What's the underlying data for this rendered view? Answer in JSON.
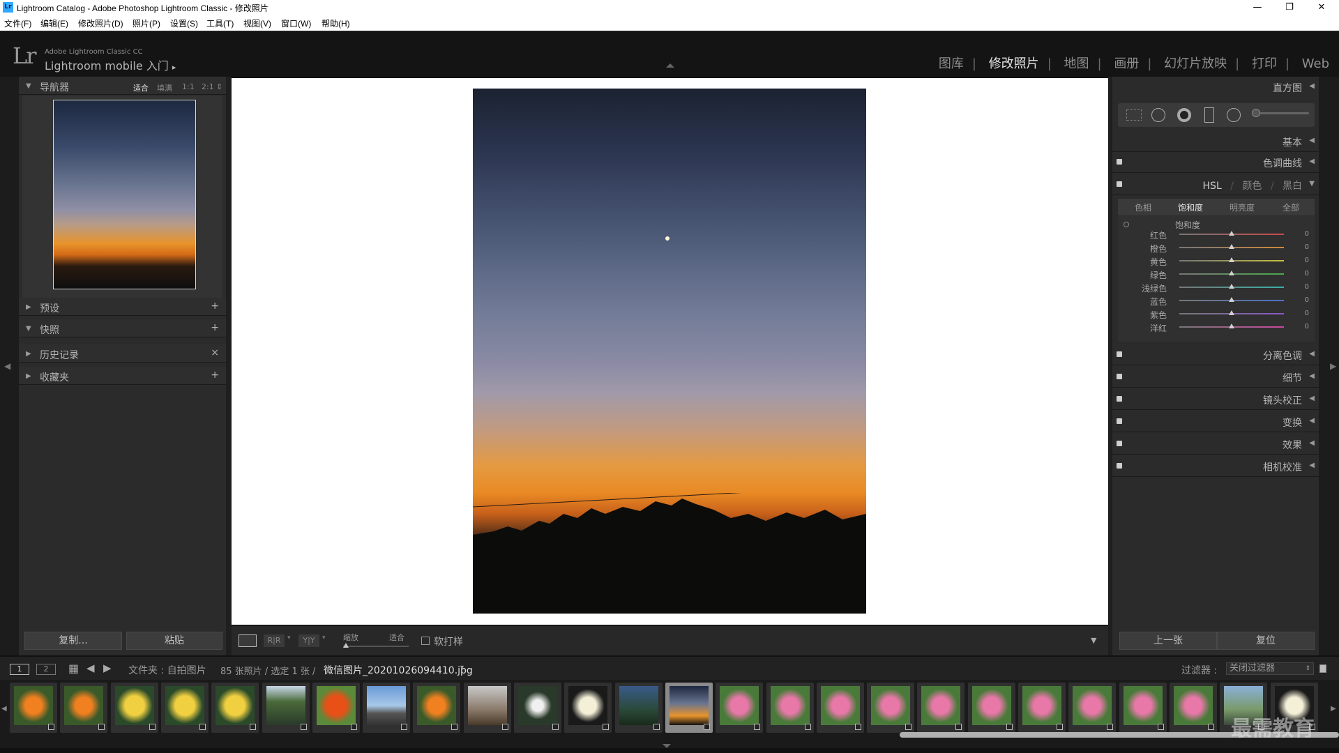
{
  "window": {
    "title": "Lightroom Catalog - Adobe Photoshop Lightroom Classic - 修改照片",
    "app_icon": "Lr",
    "controls": [
      "minimize-icon",
      "restore-icon",
      "close-icon"
    ]
  },
  "menu": [
    "文件(F)",
    "编辑(E)",
    "修改照片(D)",
    "照片(P)",
    "设置(S)",
    "工具(T)",
    "视图(V)",
    "窗口(W)",
    "帮助(H)"
  ],
  "identity": {
    "logo": "Lr",
    "product": "Adobe Lightroom Classic CC",
    "plate": "Lightroom mobile 入门",
    "arrow": "▸"
  },
  "modules": {
    "items": [
      "图库",
      "修改照片",
      "地图",
      "画册",
      "幻灯片放映",
      "打印",
      "Web"
    ],
    "active": "修改照片"
  },
  "left_panel": {
    "navigator": {
      "title": "导航器",
      "options": [
        "适合",
        "填满",
        "1:1",
        "2:1"
      ],
      "active_option": "适合"
    },
    "sections": [
      {
        "label": "预设",
        "action": "+",
        "expanded": false
      },
      {
        "label": "快照",
        "action": "+",
        "expanded": true
      },
      {
        "label": "历史记录",
        "action": "×",
        "expanded": false
      },
      {
        "label": "收藏夹",
        "action": "+",
        "expanded": false
      }
    ],
    "buttons": {
      "copy": "复制...",
      "paste": "粘贴"
    }
  },
  "right_panel": {
    "histogram": "直方图",
    "basic": "基本",
    "tone_curve": "色调曲线",
    "hsl_header": {
      "hsl": "HSL",
      "color": "颜色",
      "bw": "黑白",
      "sep": "/"
    },
    "hsl_tabs": [
      "色相",
      "饱和度",
      "明亮度",
      "全部"
    ],
    "hsl_active_tab": "饱和度",
    "group_label": "饱和度",
    "sliders": [
      {
        "name": "红色",
        "value": "0",
        "color": "#c84a4a"
      },
      {
        "name": "橙色",
        "value": "0",
        "color": "#d08a3a"
      },
      {
        "name": "黄色",
        "value": "0",
        "color": "#c8c040"
      },
      {
        "name": "绿色",
        "value": "0",
        "color": "#4aa84a"
      },
      {
        "name": "浅绿色",
        "value": "0",
        "color": "#3ab0a8"
      },
      {
        "name": "蓝色",
        "value": "0",
        "color": "#4a70c8"
      },
      {
        "name": "紫色",
        "value": "0",
        "color": "#8a5ac8"
      },
      {
        "name": "洋红",
        "value": "0",
        "color": "#c84aa0"
      }
    ],
    "panels": [
      "分离色调",
      "细节",
      "镜头校正",
      "变换",
      "效果",
      "相机校准"
    ],
    "buttons": {
      "prev": "上一张",
      "reset": "复位"
    }
  },
  "toolbar": {
    "zoom_label": "缩放",
    "fit_label": "适合",
    "soft_proof": "软打样"
  },
  "filmbar": {
    "page1": "1",
    "page2": "2",
    "folder_prefix": "文件夹 : 自拍图片",
    "count": "85 张照片 / 选定 1 张 /",
    "filename": "微信图片_20201026094410.jpg",
    "filter_label": "过滤器 :",
    "filter_value": "关闭过滤器"
  },
  "filmstrip": {
    "selected_index": 13,
    "thumbs": [
      "orange-flower",
      "orange-flower",
      "yellow-flower",
      "yellow-flower",
      "yellow-flower",
      "tree",
      "orange-lily",
      "building-sky",
      "orange-flower",
      "dry-plant",
      "white-star-flower",
      "white-flower",
      "dark-leaves",
      "night-sky",
      "lotus",
      "lotus",
      "lotus",
      "lotus",
      "lotus",
      "lotus",
      "lotus",
      "lotus",
      "lotus",
      "lotus",
      "building",
      "white-flower"
    ]
  },
  "watermark": "最需教育"
}
